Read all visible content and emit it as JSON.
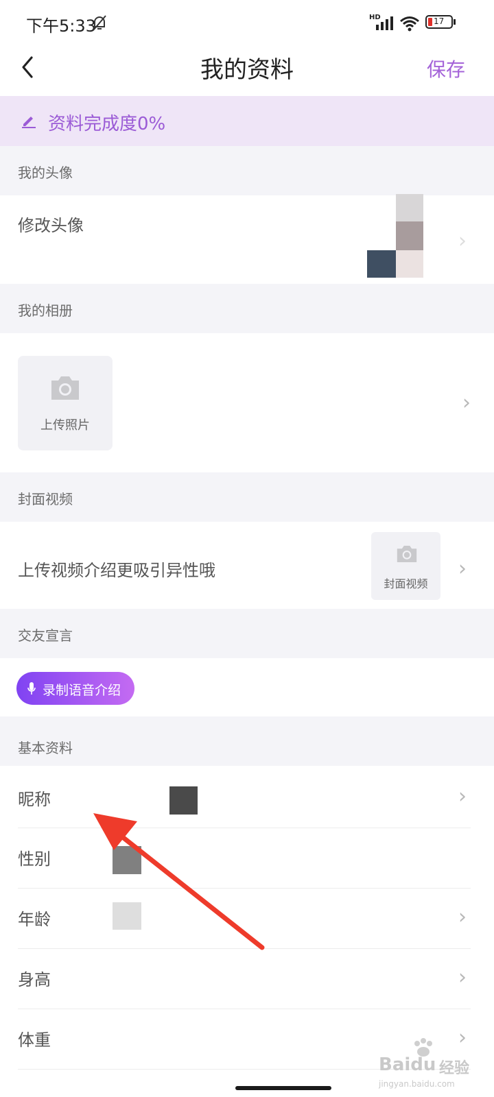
{
  "status_bar": {
    "time": "下午5:33",
    "battery": "17",
    "network": "HD"
  },
  "nav": {
    "title": "我的资料",
    "save_label": "保存"
  },
  "banner": {
    "text": "资料完成度0%"
  },
  "sections": {
    "avatar": {
      "header": "我的头像",
      "row_label": "修改头像"
    },
    "album": {
      "header": "我的相册",
      "upload_label": "上传照片"
    },
    "cover_video": {
      "header": "封面视频",
      "row_label": "上传视频介绍更吸引异性哦",
      "box_label": "封面视频"
    },
    "declaration": {
      "header": "交友宣言",
      "voice_button": "录制语音介绍"
    },
    "basic": {
      "header": "基本资料",
      "items": [
        {
          "label": "昵称"
        },
        {
          "label": "性别"
        },
        {
          "label": "年龄"
        },
        {
          "label": "身高"
        },
        {
          "label": "体重"
        }
      ]
    }
  },
  "watermark": {
    "brand": "Baidu",
    "brand_cn": "经验",
    "url": "jingyan.baidu.com"
  },
  "colors": {
    "accent": "#a463d8",
    "banner_bg": "#efe5f7",
    "section_bg": "#f4f4f8",
    "arrow": "#ee3b2b"
  }
}
